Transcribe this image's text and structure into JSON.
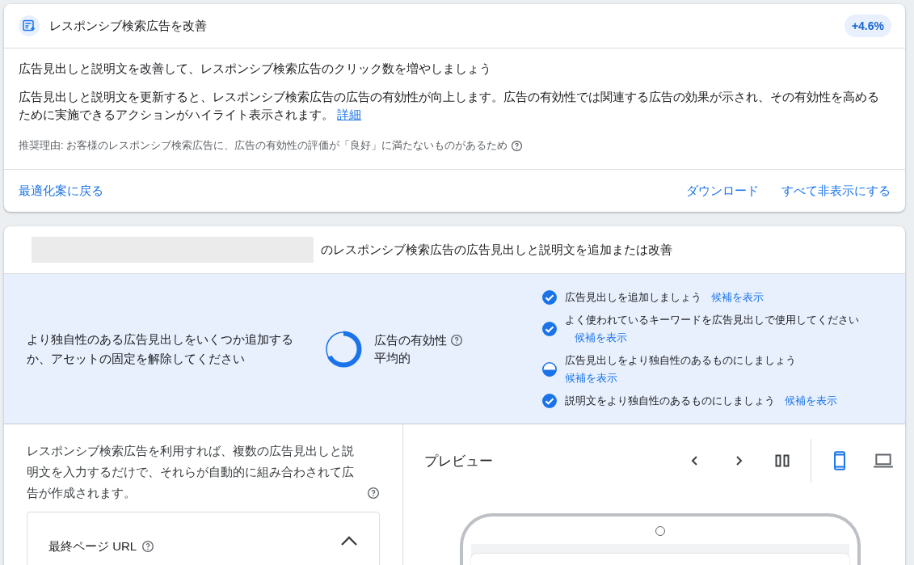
{
  "recommendation": {
    "title": "レスポンシブ検索広告を改善",
    "uplift": "+4.6%",
    "headline": "広告見出しと説明文を改善して、レスポンシブ検索広告のクリック数を増やしましょう",
    "description": "広告見出しと説明文を更新すると、レスポンシブ検索広告の広告の有効性が向上します。広告の有効性では関連する広告の効果が示され、その有効性を高めるために実施できるアクションがハイライト表示されます。",
    "details_link": "詳細",
    "reason": "推奨理由: お客様のレスポンシブ検索広告に、広告の有効性の評価が「良好」に満たないものがあるため",
    "back_link": "最適化案に戻る",
    "actions": [
      "ダウンロード",
      "すべて非表示にする"
    ]
  },
  "editor": {
    "title": "のレスポンシブ検索広告の広告見出しと説明文を追加または改善",
    "strength": {
      "advice": "より独自性のある広告見出しをいくつか追加するか、アセットの固定を解除してください",
      "label": "広告の有効性",
      "rating": "平均的",
      "level": 0.62
    },
    "checklist": [
      {
        "kind": "done",
        "text": "広告見出しを追加しましょう",
        "link": "候補を表示"
      },
      {
        "kind": "done",
        "text": "よく使われているキーワードを広告見出しで使用してください",
        "link": "候補を表示"
      },
      {
        "kind": "partial",
        "text": "広告見出しをより独自性のあるものにしましょう",
        "link": "候補を表示"
      },
      {
        "kind": "done",
        "text": "説明文をより独自性のあるものにしましょう",
        "link": "候補を表示"
      }
    ],
    "intro": "レスポンシブ検索広告を利用すれば、複数の広告見出しと説明文を入力するだけで、それらが自動的に組み合わされて広告が作成されます。",
    "url_section": {
      "label": "最終ページ URL",
      "expanded": true
    },
    "preview": {
      "title": "プレビュー",
      "devices": [
        {
          "kind": "mobile",
          "selected": true
        },
        {
          "kind": "desktop",
          "selected": false
        }
      ]
    }
  }
}
